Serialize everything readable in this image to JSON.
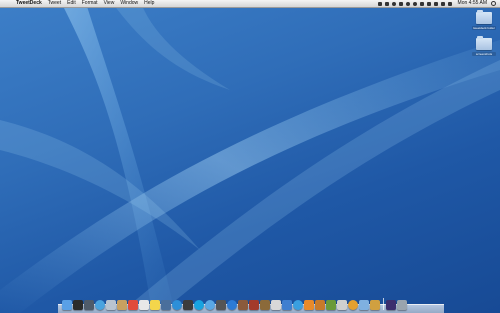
{
  "menubar": {
    "apple_glyph": "",
    "app_name": "TweetDeck",
    "menus": [
      "Tweet",
      "Edit",
      "Format",
      "View",
      "Window",
      "Help"
    ],
    "clock": "Mon 4:55 AM",
    "status_icons": [
      "dropbox-icon",
      "evernote-icon",
      "growl-icon",
      "cloud-icon",
      "gear-icon",
      "timemachine-icon",
      "bluetooth-icon",
      "wifi-icon",
      "volume-icon",
      "battery-icon",
      "flag-icon"
    ]
  },
  "desktop": {
    "icons": [
      {
        "label": "tweetdeck folder",
        "icon": "folder-icon"
      },
      {
        "label": "screenshots",
        "icon": "folder-icon"
      }
    ]
  },
  "dock": {
    "apps": [
      {
        "name": "finder-icon",
        "color": "#5aa0e6"
      },
      {
        "name": "dashboard-icon",
        "color": "#2b2b2b"
      },
      {
        "name": "expose-icon",
        "color": "#4f5b6a"
      },
      {
        "name": "safari-icon",
        "color": "#4aa3df"
      },
      {
        "name": "mail-icon",
        "color": "#b9c4d0"
      },
      {
        "name": "address-book-icon",
        "color": "#c8a060"
      },
      {
        "name": "ical-icon",
        "color": "#e04b3a"
      },
      {
        "name": "preview-icon",
        "color": "#e8e8e8"
      },
      {
        "name": "stickies-icon",
        "color": "#f3d64b"
      },
      {
        "name": "iphoto-icon",
        "color": "#4a6f9c"
      },
      {
        "name": "itunes-icon",
        "color": "#2d8fd8"
      },
      {
        "name": "tweetdeck-icon",
        "color": "#3c3c3c"
      },
      {
        "name": "skype-icon",
        "color": "#18a3e0"
      },
      {
        "name": "chat-icon",
        "color": "#5aa8e4"
      },
      {
        "name": "camera-icon",
        "color": "#555555"
      },
      {
        "name": "app-store-icon",
        "color": "#2c7bd6"
      },
      {
        "name": "tools-icon",
        "color": "#8a5a3c"
      },
      {
        "name": "photo-booth-icon",
        "color": "#a33a2a"
      },
      {
        "name": "image-capture-icon",
        "color": "#8b6a3a"
      },
      {
        "name": "textedit-icon",
        "color": "#d8d8d8"
      },
      {
        "name": "activity-icon",
        "color": "#3f7fd0"
      },
      {
        "name": "globe-icon",
        "color": "#3a9fe0"
      },
      {
        "name": "vlc-icon",
        "color": "#e88a2a"
      },
      {
        "name": "script-editor-icon",
        "color": "#c87a2a"
      },
      {
        "name": "terminal-icon",
        "color": "#6a9a3a"
      },
      {
        "name": "paintbrush-icon",
        "color": "#cfcfcf"
      },
      {
        "name": "chrome-icon",
        "color": "#e4a030"
      },
      {
        "name": "cursor-icon",
        "color": "#7fb0e0"
      },
      {
        "name": "pencil-icon",
        "color": "#d0a040"
      }
    ],
    "right_items": [
      {
        "name": "applications-stack-icon",
        "color": "#3b2d6e"
      },
      {
        "name": "trash-icon",
        "color": "#9aa4ae"
      }
    ]
  }
}
